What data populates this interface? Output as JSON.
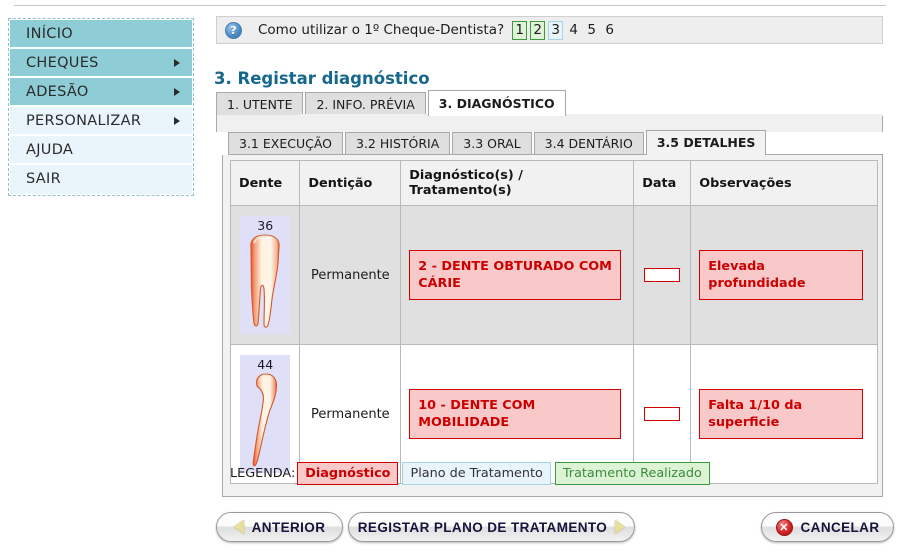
{
  "sidebar": {
    "items": [
      {
        "label": "INÍCIO",
        "style": "teal",
        "arrow": false
      },
      {
        "label": "CHEQUES",
        "style": "teal",
        "arrow": true
      },
      {
        "label": "ADESÃO",
        "style": "teal",
        "arrow": true
      },
      {
        "label": "PERSONALIZAR",
        "style": "pale",
        "arrow": true
      },
      {
        "label": "AJUDA",
        "style": "pale",
        "arrow": false
      },
      {
        "label": "SAIR",
        "style": "pale",
        "arrow": false
      }
    ]
  },
  "helpbar": {
    "icon": "help-question-icon",
    "icon_glyph": "?",
    "text": "Como utilizar o 1º Cheque-Dentista?",
    "steps": [
      {
        "label": "1",
        "state": "green"
      },
      {
        "label": "2",
        "state": "green"
      },
      {
        "label": "3",
        "state": "blue"
      },
      {
        "label": "4",
        "state": "plain"
      },
      {
        "label": "5",
        "state": "plain"
      },
      {
        "label": "6",
        "state": "plain"
      }
    ]
  },
  "page": {
    "title": "3. Registar diagnóstico"
  },
  "tabs_primary": [
    {
      "label": "1. UTENTE",
      "active": false
    },
    {
      "label": "2. INFO. PRÉVIA",
      "active": false
    },
    {
      "label": "3. DIAGNÓSTICO",
      "active": true
    }
  ],
  "tabs_secondary": [
    {
      "label": "3.1 EXECUÇÃO",
      "active": false
    },
    {
      "label": "3.2 HISTÓRIA",
      "active": false
    },
    {
      "label": "3.3 ORAL",
      "active": false
    },
    {
      "label": "3.4 DENTÁRIO",
      "active": false
    },
    {
      "label": "3.5 DETALHES",
      "active": true
    }
  ],
  "table": {
    "headers": [
      "Dente",
      "Dentição",
      "Diagnóstico(s) / Tratamento(s)",
      "Data",
      "Observações"
    ],
    "rows": [
      {
        "tooth_number": "36",
        "tooth_type": "molar",
        "denticao": "Permanente",
        "diagnostico": "2 - DENTE OBTURADO COM CÁRIE",
        "data": "",
        "observacoes": "Elevada profundidade"
      },
      {
        "tooth_number": "44",
        "tooth_type": "premolar",
        "denticao": "Permanente",
        "diagnostico": "10 - DENTE COM MOBILIDADE",
        "data": "",
        "observacoes": "Falta 1/10 da superficie"
      }
    ]
  },
  "legend": {
    "label": "LEGENDA:",
    "chips": [
      {
        "label": "Diagnóstico",
        "state": "diagnostico"
      },
      {
        "label": "Plano de Tratamento",
        "state": "plano"
      },
      {
        "label": "Tratamento Realizado",
        "state": "realizado"
      }
    ]
  },
  "buttons": {
    "anterior": "ANTERIOR",
    "registar": "REGISTAR PLANO DE TRATAMENTO",
    "cancelar": "CANCELAR",
    "cancel_icon_glyph": "✕"
  },
  "colors": {
    "accent_teal": "#8ecdd5",
    "title_blue": "#15678e",
    "diagnostic_red": "#cc0000",
    "diagnostic_fill": "#f9c9c9",
    "treatment_blue": "#e8f4fa",
    "done_green": "#ddf3d6",
    "tooth_bg": "#dfe0f7"
  }
}
